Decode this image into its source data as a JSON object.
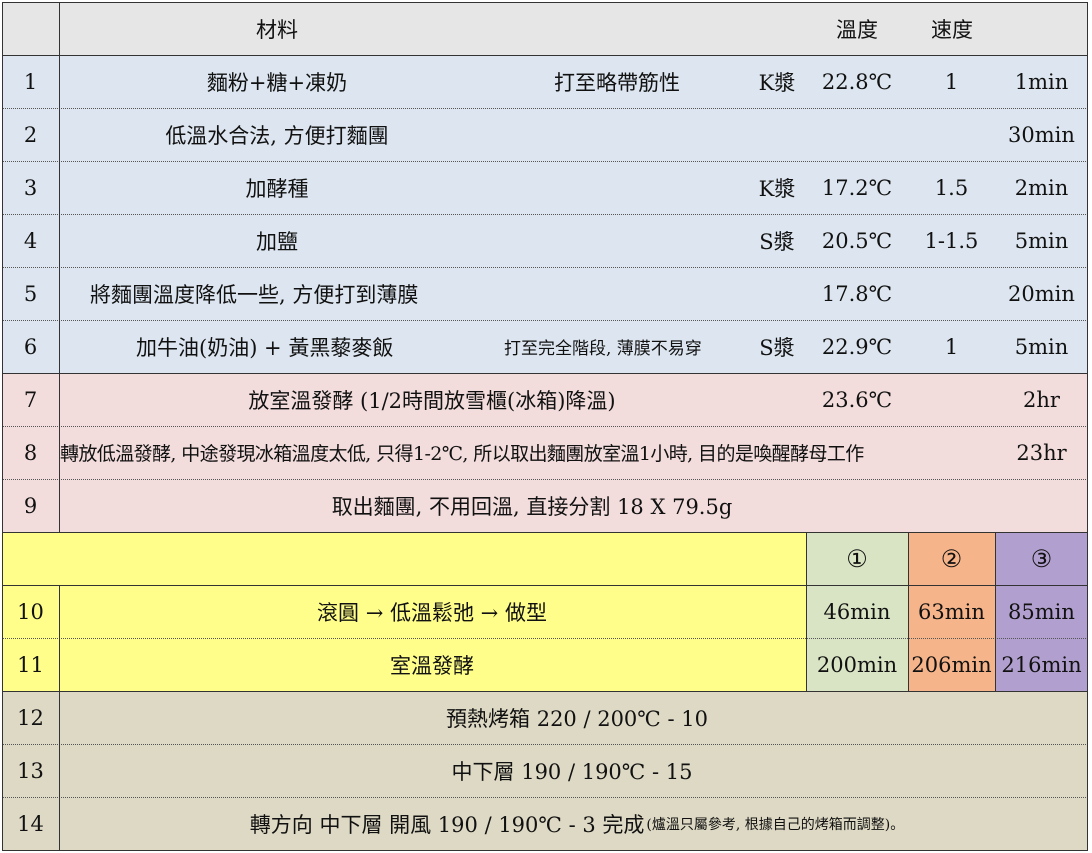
{
  "colors": {
    "header_bg": "#e6e6e6",
    "blue_bg": "#dde6f0",
    "pink_bg": "#f2dcdc",
    "yellow_bg": "#fffe8a",
    "green_bg": "#d9e4c4",
    "orange_bg": "#f6b48a",
    "purple_bg": "#b1a0cf",
    "tan_bg": "#ddd9c4"
  },
  "header": {
    "material": "材料",
    "temp": "溫度",
    "speed": "速度"
  },
  "rows": {
    "r1": {
      "num": "1",
      "text": "麵粉+糖+凍奶",
      "note": "打至略帶筋性",
      "paddle": "K漿",
      "temp": "22.8℃",
      "speed": "1",
      "time": "1min"
    },
    "r2": {
      "num": "2",
      "text": "低溫水合法, 方便打麵團",
      "time": "30min"
    },
    "r3": {
      "num": "3",
      "text": "加酵種",
      "paddle": "K漿",
      "temp": "17.2℃",
      "speed": "1.5",
      "time": "2min"
    },
    "r4": {
      "num": "4",
      "text": "加鹽",
      "paddle": "S漿",
      "temp": "20.5℃",
      "speed": "1-1.5",
      "time": "5min"
    },
    "r5": {
      "num": "5",
      "text": "將麵團溫度降低一些, 方便打到薄膜",
      "temp": "17.8℃",
      "time": "20min"
    },
    "r6": {
      "num": "6",
      "text": "加牛油(奶油) + 黃黑藜麥飯",
      "note": "打至完全階段, 薄膜不易穿",
      "paddle": "S漿",
      "temp": "22.9℃",
      "speed": "1",
      "time": "5min"
    },
    "r7": {
      "num": "7",
      "text": "放室溫發酵 (1/2時間放雪櫃(冰箱)降溫)",
      "temp": "23.6℃",
      "time": "2hr"
    },
    "r8": {
      "num": "8",
      "text": "轉放低溫發酵, 中途發現冰箱溫度太低, 只得1-2℃, 所以取出麵團放室溫1小時, 目的是喚醒酵母工作",
      "time": "23hr"
    },
    "r9": {
      "num": "9",
      "text": "取出麵團, 不用回溫, 直接分割 18 X 79.5g"
    },
    "batches": {
      "b1": "①",
      "b2": "②",
      "b3": "③"
    },
    "r10": {
      "num": "10",
      "text": "滾圓 → 低溫鬆弛 → 做型",
      "t1": "46min",
      "t2": "63min",
      "t3": "85min"
    },
    "r11": {
      "num": "11",
      "text": "室溫發酵",
      "t1": "200min",
      "t2": "206min",
      "t3": "216min"
    },
    "r12": {
      "num": "12",
      "text": "預熱烤箱  220 / 200℃ - 10"
    },
    "r13": {
      "num": "13",
      "text": "中下層  190 / 190℃ - 15"
    },
    "r14": {
      "num": "14",
      "text": "轉方向 中下層 開風  190 / 190℃ - 3 完成",
      "note": "(爐溫只屬參考, 根據自己的烤箱而調整)。"
    }
  }
}
